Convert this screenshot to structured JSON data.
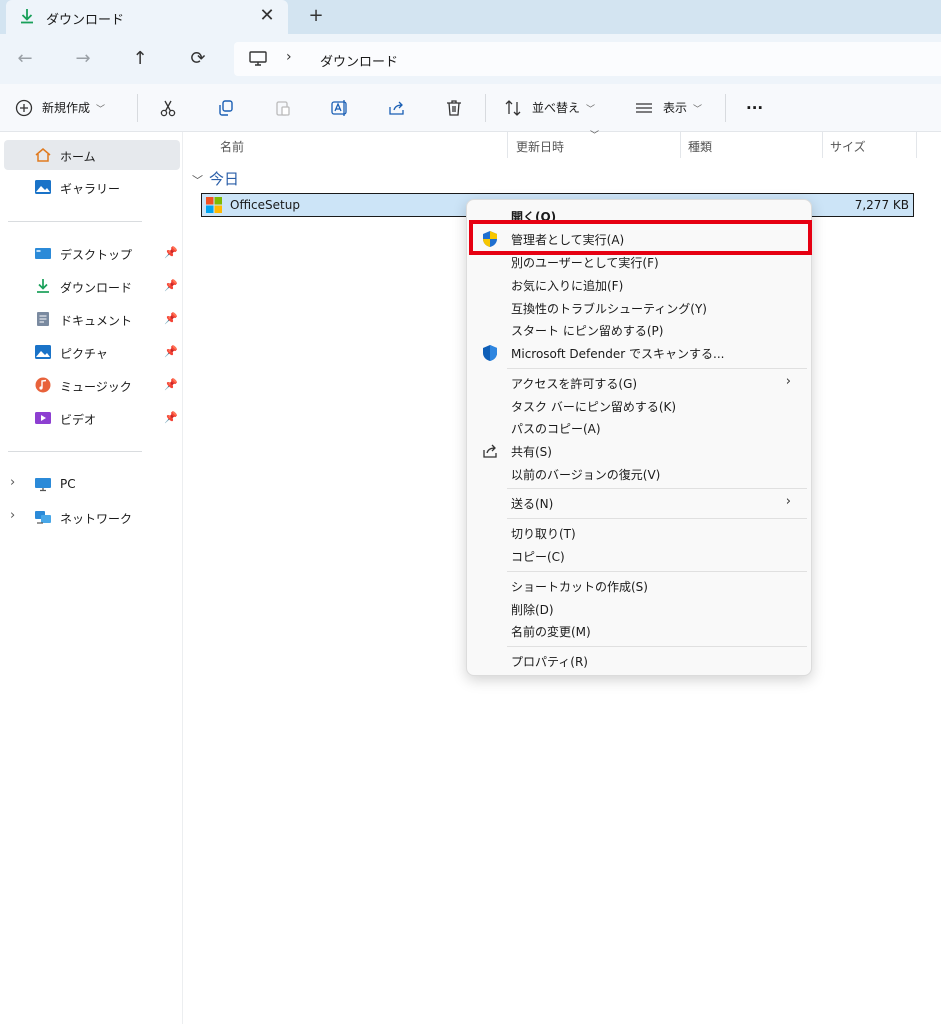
{
  "tab": {
    "label": "ダウンロード",
    "close": "✕",
    "new": "+"
  },
  "nav": {
    "back": "←",
    "forward": "→",
    "up": "↑",
    "refresh": "⟳"
  },
  "breadcrumb": {
    "separator": "›",
    "location": "ダウンロード"
  },
  "toolbar": {
    "new_label": "新規作成",
    "sort_label": "並べ替え",
    "view_label": "表示",
    "more_label": "···"
  },
  "sidebar": {
    "home": "ホーム",
    "gallery": "ギャラリー",
    "quick": [
      {
        "label": "デスクトップ",
        "icon": "desktop-icon"
      },
      {
        "label": "ダウンロード",
        "icon": "download-icon"
      },
      {
        "label": "ドキュメント",
        "icon": "document-icon"
      },
      {
        "label": "ピクチャ",
        "icon": "picture-icon"
      },
      {
        "label": "ミュージック",
        "icon": "music-icon"
      },
      {
        "label": "ビデオ",
        "icon": "video-icon"
      }
    ],
    "pc": "PC",
    "network": "ネットワーク"
  },
  "columns": {
    "name": "名前",
    "modified": "更新日時",
    "type": "種類",
    "size": "サイズ"
  },
  "group": {
    "label": "今日"
  },
  "file": {
    "name": "OfficeSetup",
    "size": "7,277 KB"
  },
  "menu": {
    "open": "開く(O)",
    "run_as_admin": "管理者として実行(A)",
    "run_as_other": "別のユーザーとして実行(F)",
    "add_favorites": "お気に入りに追加(F)",
    "troubleshoot": "互換性のトラブルシューティング(Y)",
    "pin_start": "スタート にピン留めする(P)",
    "defender": "Microsoft Defender でスキャンする...",
    "grant_access": "アクセスを許可する(G)",
    "pin_taskbar": "タスク バーにピン留めする(K)",
    "copy_path": "パスのコピー(A)",
    "share": "共有(S)",
    "restore": "以前のバージョンの復元(V)",
    "send_to": "送る(N)",
    "cut": "切り取り(T)",
    "copy": "コピー(C)",
    "shortcut": "ショートカットの作成(S)",
    "delete": "削除(D)",
    "rename": "名前の変更(M)",
    "properties": "プロパティ(R)",
    "submenu_arrow": "›"
  },
  "colors": {
    "accent": "#0067c0",
    "highlight_box": "#e60012",
    "selection": "#cce4f7"
  }
}
